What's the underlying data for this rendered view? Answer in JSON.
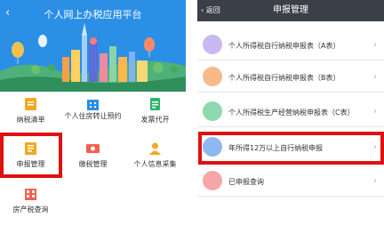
{
  "left": {
    "header_title": "个人网上办税应用平台",
    "grid": [
      {
        "label": "纳税清单",
        "icon": "tax-list-icon",
        "color": "#f5a623"
      },
      {
        "label": "个人住房转让预约",
        "icon": "house-transfer-icon",
        "color": "#2b8fe6"
      },
      {
        "label": "发票代开",
        "icon": "invoice-icon",
        "color": "#2db56b"
      },
      {
        "label": "申报管理",
        "icon": "declaration-icon",
        "color": "#f5a623"
      },
      {
        "label": "缴税管理",
        "icon": "payment-icon",
        "color": "#f06050"
      },
      {
        "label": "个人信息采集",
        "icon": "person-info-icon",
        "color": "#f5a623"
      },
      {
        "label": "房产税查询",
        "icon": "property-tax-icon",
        "color": "#f06050"
      }
    ]
  },
  "right": {
    "back_label": "返回",
    "title": "申报管理",
    "rows": [
      {
        "label": "个人所得税自行纳税申报表（A表）",
        "icon": "form-a-icon",
        "color": "#c9b8f0"
      },
      {
        "label": "个人所得税自行纳税申报表（B表）",
        "icon": "form-b-icon",
        "color": "#f7b98a"
      },
      {
        "label": "个人所得税生产经营纳税申报表（C表）",
        "icon": "form-c-icon",
        "color": "#8fd9b0"
      },
      {
        "label": "年所得12万以上自行纳税申报",
        "icon": "annual-income-icon",
        "color": "#8fb8f0"
      },
      {
        "label": "已申报查询",
        "icon": "declared-query-icon",
        "color": "#f6a6a6"
      }
    ]
  }
}
